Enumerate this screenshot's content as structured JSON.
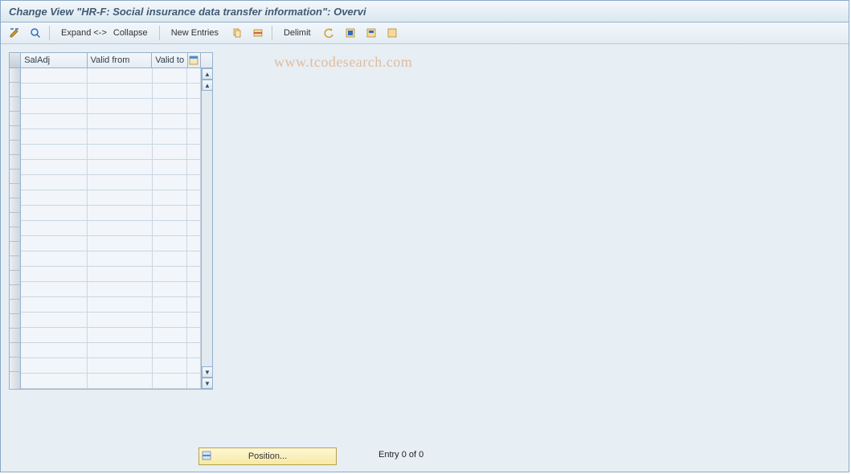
{
  "title": "Change View \"HR-F: Social insurance data transfer information\": Overvi",
  "toolbar": {
    "expand": "Expand <->",
    "collapse": "Collapse",
    "new_entries": "New Entries",
    "delimit": "Delimit"
  },
  "grid": {
    "headers": {
      "saladj": "SalAdj",
      "valid_from": "Valid from",
      "valid_to": "Valid to"
    },
    "row_count": 21
  },
  "footer": {
    "position_label": "Position...",
    "entry_status": "Entry 0 of 0"
  },
  "watermark": "www.tcodesearch.com"
}
